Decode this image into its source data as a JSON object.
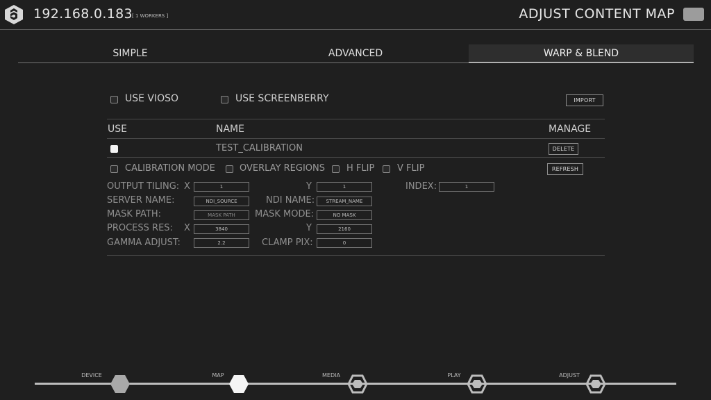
{
  "header": {
    "ip": "192.168.0.183",
    "workers": "[ 1 WORKERS ]",
    "title": "ADJUST CONTENT MAP"
  },
  "tabs": [
    {
      "label": "SIMPLE"
    },
    {
      "label": "ADVANCED"
    },
    {
      "label": "WARP & BLEND",
      "active": true
    }
  ],
  "options": {
    "use_vioso": "USE VIOSO",
    "use_screenberry": "USE SCREENBERRY",
    "import": "IMPORT"
  },
  "table": {
    "headers": [
      "USE",
      "NAME",
      "MANAGE"
    ],
    "rows": [
      {
        "use": true,
        "name": "TEST_CALIBRATION",
        "action": "DELETE"
      }
    ]
  },
  "toggles": {
    "calibration_mode": "CALIBRATION MODE",
    "overlay_regions": "OVERLAY REGIONS",
    "h_flip": "H FLIP",
    "v_flip": "V FLIP",
    "refresh": "REFRESH"
  },
  "settings": {
    "output_tiling": {
      "label": "OUTPUT TILING:",
      "x_label": "X",
      "x": "1",
      "y_label": "Y",
      "y": "1"
    },
    "index": {
      "label": "INDEX:",
      "value": "1"
    },
    "server_name": {
      "label": "SERVER NAME:",
      "value": "NDI_SOURCE"
    },
    "ndi_name": {
      "label": "NDI NAME:",
      "value": "STREAM_NAME"
    },
    "mask_path": {
      "label": "MASK PATH:",
      "value": "MASK PATH"
    },
    "mask_mode": {
      "label": "MASK MODE:",
      "value": "NO MASK"
    },
    "process_res": {
      "label": "PROCESS RES:",
      "x_label": "X",
      "x": "3840",
      "y_label": "Y",
      "y": "2160"
    },
    "gamma_adjust": {
      "label": "GAMMA ADJUST:",
      "value": "2.2"
    },
    "clamp_pix": {
      "label": "CLAMP PIX:",
      "value": "0"
    }
  },
  "pipeline": {
    "steps": [
      {
        "label": "DEVICE"
      },
      {
        "label": "MAP"
      },
      {
        "label": "MEDIA"
      },
      {
        "label": "PLAY"
      },
      {
        "label": "ADJUST"
      }
    ]
  },
  "colors": {
    "background": "#1f1f1f",
    "text": "#cfcfcf",
    "accent": "#f4f4f4"
  }
}
